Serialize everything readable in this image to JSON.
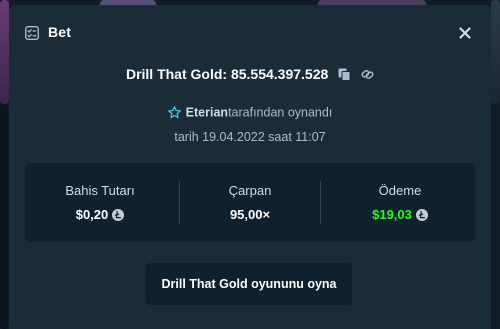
{
  "modal": {
    "title": "Bet",
    "title_icon": "bet-slip-icon",
    "close_icon": "close-icon"
  },
  "bet": {
    "game_and_id": "Drill That Gold: 85.554.397.528",
    "copy_icon": "copy-icon",
    "link_icon": "link-icon",
    "player_icon": "star-badge-icon",
    "player_name": "Eterian",
    "player_suffix": "tarafından oynandı",
    "date_text": "tarih 19.04.2022 saat 11:07"
  },
  "stats": {
    "amount_label": "Bahis Tutarı",
    "amount_value": "$0,20",
    "multiplier_label": "Çarpan",
    "multiplier_value": "95,00×",
    "payout_label": "Ödeme",
    "payout_value": "$19,03",
    "currency_icon": "litecoin-icon"
  },
  "actions": {
    "play_label": "Drill That Gold oyununu oyna"
  },
  "colors": {
    "modal_bg": "#1a2c38",
    "panel_bg": "#0f212e",
    "win_green": "#1fff20",
    "muted_text": "#b1bad3",
    "accent_teal": "#44c9e0"
  }
}
